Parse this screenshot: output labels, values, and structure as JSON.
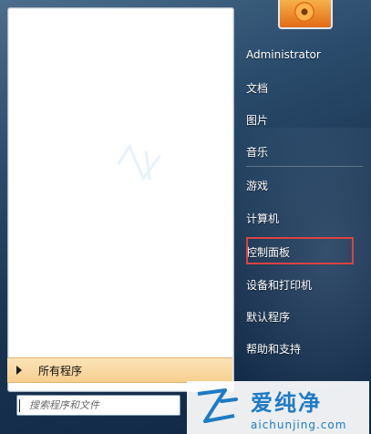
{
  "user": {
    "name": "Administrator"
  },
  "right_items": [
    {
      "label": "文档"
    },
    {
      "label": "图片"
    },
    {
      "label": "音乐"
    },
    {
      "label": "游戏"
    },
    {
      "label": "计算机"
    },
    {
      "label": "控制面板"
    },
    {
      "label": "设备和打印机"
    },
    {
      "label": "默认程序"
    },
    {
      "label": "帮助和支持"
    }
  ],
  "all_programs": {
    "label": "所有程序"
  },
  "search": {
    "placeholder": "搜索程序和文件"
  },
  "watermark": {
    "main": "爱纯净",
    "sub": "aichunjing.com"
  },
  "colors": {
    "highlight": "#d94343",
    "watermark": "#1e7bc4"
  }
}
